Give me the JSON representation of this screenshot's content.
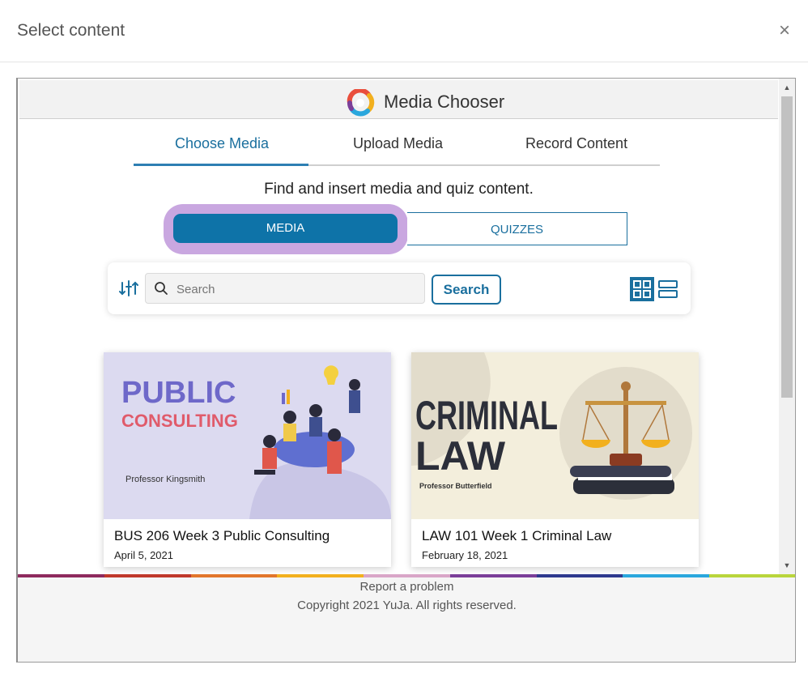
{
  "dialog": {
    "title": "Select content",
    "close_label": "×"
  },
  "chooser": {
    "title": "Media Chooser"
  },
  "tabs": [
    {
      "label": "Choose Media",
      "active": true
    },
    {
      "label": "Upload Media",
      "active": false
    },
    {
      "label": "Record Content",
      "active": false
    }
  ],
  "instruction": "Find and insert media and quiz content.",
  "toggle": {
    "media_label": "MEDIA",
    "quizzes_label": "QUIZZES"
  },
  "search": {
    "placeholder": "Search",
    "button_label": "Search"
  },
  "cards": [
    {
      "title": "BUS 206 Week 3 Public Consulting",
      "date": "April 5, 2021",
      "thumb_heading_1": "PUBLIC",
      "thumb_heading_2": "CONSULTING",
      "thumb_subtitle": "Professor Kingsmith"
    },
    {
      "title": "LAW 101 Week 1 Criminal Law",
      "date": "February 18, 2021",
      "thumb_heading_1": "CRIMINAL",
      "thumb_heading_2": "LAW",
      "thumb_subtitle": "Professor Butterfield"
    }
  ],
  "footer": {
    "report_label": "Report a problem",
    "copyright": "Copyright 2021 YuJa. All rights reserved.",
    "stripe_colors": [
      "#8e2a5e",
      "#c0392b",
      "#e2762b",
      "#f2b01e",
      "#d9a6c8",
      "#7b3f99",
      "#2f3a8f",
      "#2aa7dd",
      "#b9d53c"
    ]
  },
  "colors": {
    "accent": "#1a6f9e",
    "highlight": "#c9a7e0"
  }
}
